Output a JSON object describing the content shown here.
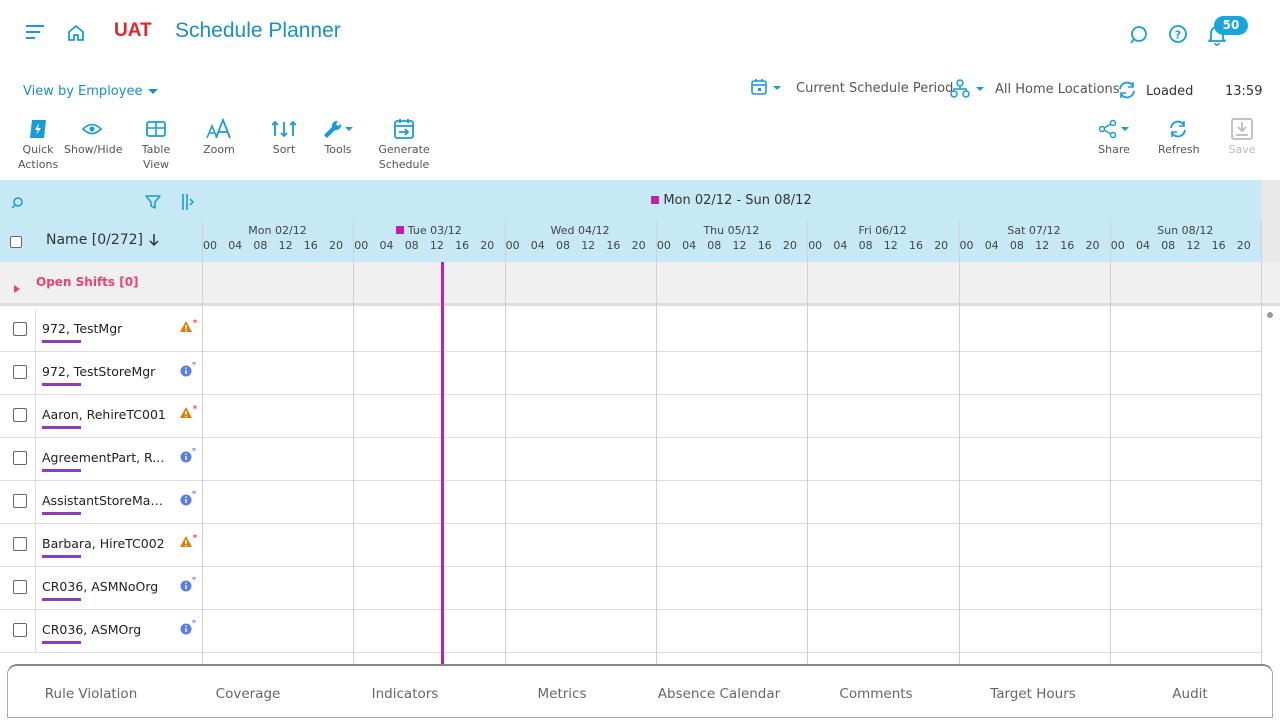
{
  "header": {
    "env_label": "UAT",
    "app_title": "Schedule Planner",
    "notification_count": "50"
  },
  "toolbar_top": {
    "view_by": "View by Employee",
    "schedule_period": "Current Schedule Period",
    "locations": "All Home Locations",
    "load_status": "Loaded",
    "time": "13:59"
  },
  "toolbar": {
    "quick_actions": "Quick Actions",
    "show_hide": "Show/Hide",
    "table_view": "Table View",
    "zoom": "Zoom",
    "sort": "Sort",
    "tools": "Tools",
    "generate_schedule": "Generate Schedule",
    "share": "Share",
    "refresh": "Refresh",
    "save": "Save"
  },
  "grid": {
    "week_label": "Mon 02/12 - Sun 08/12",
    "name_header": "Name [0/272]",
    "days": [
      "Mon 02/12",
      "Tue 03/12",
      "Wed 04/12",
      "Thu 05/12",
      "Fri 06/12",
      "Sat 07/12",
      "Sun 08/12"
    ],
    "hours": [
      "00",
      "04",
      "08",
      "12",
      "16",
      "20"
    ],
    "open_shifts": "Open Shifts [0]",
    "employees": [
      {
        "name": "972, TestMgr",
        "status": "warning"
      },
      {
        "name": "972, TestStoreMgr",
        "status": "info"
      },
      {
        "name": "Aaron, RehireTC001",
        "status": "warning"
      },
      {
        "name": "AgreementPart, Reg...",
        "status": "info"
      },
      {
        "name": "AssistantStoreMana...",
        "status": "info"
      },
      {
        "name": "Barbara, HireTC002",
        "status": "warning"
      },
      {
        "name": "CR036, ASMNoOrg",
        "status": "info"
      },
      {
        "name": "CR036, ASMOrg",
        "status": "info"
      }
    ]
  },
  "bottom_tabs": [
    "Rule Violation",
    "Coverage",
    "Indicators",
    "Metrics",
    "Absence Calendar",
    "Comments",
    "Target Hours",
    "Audit"
  ],
  "colors": {
    "accent": "#1a8fc4",
    "env": "#e0262d",
    "today": "#c21fb1",
    "employee_bar": "#8a3fb5",
    "warning": "#d4830a",
    "info": "#5b7fe0",
    "open_shifts": "#e8446a"
  }
}
